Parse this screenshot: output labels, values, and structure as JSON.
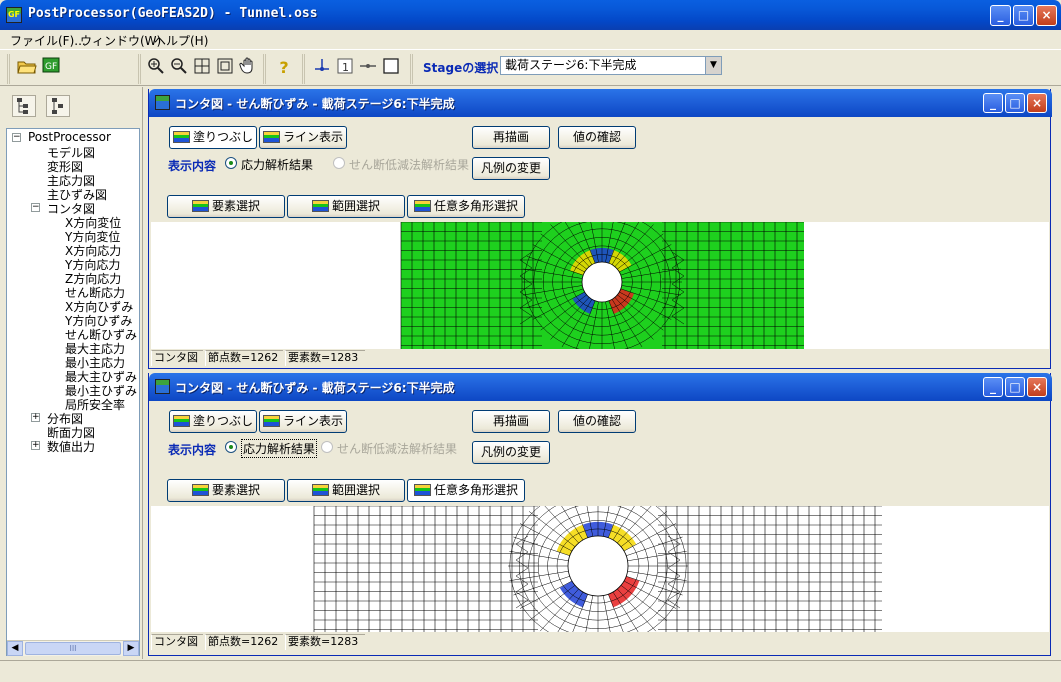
{
  "app": {
    "title": "PostProcessor(GeoFEAS2D) - Tunnel.oss",
    "icon_text": "GF",
    "title_buttons": [
      "_",
      "□",
      "×"
    ]
  },
  "menu": [
    "ファイル(F)...",
    "ウィンドウ(W)",
    "ヘルプ(H)"
  ],
  "toolbar": {
    "icons": [
      "open-folder-icon",
      "app-icon",
      "zoom-in-icon",
      "zoom-out-icon",
      "zoom-window-icon",
      "zoom-fit-icon",
      "pan-hand-icon",
      "help-icon",
      "node-icon",
      "number-icon",
      "line-icon",
      "rectangle-icon"
    ],
    "stage_label": "Stageの選択",
    "stage_value": "載荷ステージ6:下半完成"
  },
  "tree": {
    "items": [
      {
        "label": "PostProcessor",
        "level": 0,
        "expander": "−"
      },
      {
        "label": "モデル図",
        "level": 1
      },
      {
        "label": "変形図",
        "level": 1
      },
      {
        "label": "主応力図",
        "level": 1
      },
      {
        "label": "主ひずみ図",
        "level": 1
      },
      {
        "label": "コンタ図",
        "level": 1,
        "expander": "−"
      },
      {
        "label": "X方向変位",
        "level": 2
      },
      {
        "label": "Y方向変位",
        "level": 2
      },
      {
        "label": "X方向応力",
        "level": 2
      },
      {
        "label": "Y方向応力",
        "level": 2
      },
      {
        "label": "Z方向応力",
        "level": 2
      },
      {
        "label": "せん断応力",
        "level": 2
      },
      {
        "label": "X方向ひずみ",
        "level": 2
      },
      {
        "label": "Y方向ひずみ",
        "level": 2
      },
      {
        "label": "せん断ひずみ",
        "level": 2
      },
      {
        "label": "最大主応力",
        "level": 2
      },
      {
        "label": "最小主応力",
        "level": 2
      },
      {
        "label": "最大主ひずみ",
        "level": 2
      },
      {
        "label": "最小主ひずみ",
        "level": 2
      },
      {
        "label": "局所安全率",
        "level": 2
      },
      {
        "label": "分布図",
        "level": 1,
        "expander": "+"
      },
      {
        "label": "断面力図",
        "level": 1
      },
      {
        "label": "数値出力",
        "level": 1,
        "expander": "+"
      }
    ],
    "scroll_grip": "III"
  },
  "windows": [
    {
      "title": "コンタ図 - せん断ひずみ - 載荷ステージ6:下半完成",
      "fill_button": "塗りつぶし",
      "line_button": "ライン表示",
      "redraw_button": "再描画",
      "check_button": "値の確認",
      "legend_button": "凡例の変更",
      "display_label": "表示内容",
      "radio_stress": "応力解析結果",
      "radio_ssr": "せん断低減法解析結果",
      "element_select": "要素選択",
      "range_select": "範囲選択",
      "polygon_select": "任意多角形選択",
      "mode": "fill",
      "status": [
        "コンタ図",
        "節点数=1262",
        "要素数=1283"
      ]
    },
    {
      "title": "コンタ図 - せん断ひずみ - 載荷ステージ6:下半完成",
      "fill_button": "塗りつぶし",
      "line_button": "ライン表示",
      "redraw_button": "再描画",
      "check_button": "値の確認",
      "legend_button": "凡例の変更",
      "display_label": "表示内容",
      "radio_stress": "応力解析結果",
      "radio_ssr": "せん断低減法解析結果",
      "element_select": "要素選択",
      "range_select": "範囲選択",
      "polygon_select": "任意多角形選択",
      "mode": "line",
      "status": [
        "コンタ図",
        "節点数=1262",
        "要素数=1283"
      ]
    }
  ],
  "colors": {
    "mesh_fill": "#1ed01e",
    "mesh_line": "#000000",
    "title_blue": "#0a2ab5",
    "contour_yellow": "#f5d800",
    "contour_blue": "#1f3fd6",
    "contour_red": "#e61e1e"
  }
}
